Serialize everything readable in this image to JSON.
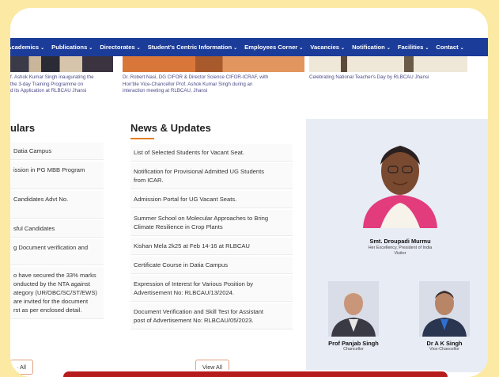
{
  "nav": {
    "items": [
      "Academics",
      "Publications",
      "Directorates",
      "Student's Centric Information",
      "Employees Corner",
      "Vacancies",
      "Notification",
      "Facilities",
      "Contact"
    ]
  },
  "gallery": {
    "captions": [
      "f. Ashok Kumar Singh inaugurating the\nthe 3-day Training Programme on\nd its Application at RLBCAU Jhansi",
      "Dr. Robert Nasi, DG CIFOR & Director Science CIFOR-ICRAF, with\nHon'ble Vice-Chancellor Prof. Ashok Kumar Singh during an\ninteraction meeting at RLBCAU, Jhansi",
      "Celebrating National Teacher's Day by RLBCAU Jhansi"
    ]
  },
  "circulars": {
    "title": "ulars",
    "items": [
      "Datia Campus",
      "ission in PG MBB Program",
      "Candidates Advt No.",
      "sful Candidates",
      "g Document verification and",
      "o have secured the 33% marks\nonducted by the NTA against\nategory (UR/OBC/SC/ST/EWS)\nare invited for the document\nrst as per enclosed detail."
    ],
    "view_all": "· All"
  },
  "news": {
    "title": "News & Updates",
    "items": [
      "List of Selected Students for Vacant Seat.",
      "Notification for Provisional Admitted UG Students\nfrom ICAR.",
      "Admission Portal for UG Vacant Seats.",
      "Summer School on Molecular Approaches to Bring\nClimate Resilience in Crop Plants",
      "Kishan Mela 2k25 at Feb 14-16 at RLBCAU",
      "Certificate Course in Datia Campus",
      "Expression of Interest for Various Position by\nAdvertisement No: RLBCAU/13/2024.",
      "Document Verification and Skill Test for Assistant\npost of Advertisement No: RLBCAU/05/2023."
    ],
    "view_all": "View All"
  },
  "visitor": {
    "name": "Smt. Droupadi Murmu",
    "title": "Her Excellency, President of India\nVisitor"
  },
  "chancellor": {
    "name": "Prof Panjab Singh",
    "title": "Chancellor"
  },
  "vice_chancellor": {
    "name": "Dr A K Singh",
    "title": "Vice-Chancellor"
  },
  "colors": {
    "nav": "#1c3c9a",
    "accent": "#e67e22",
    "panel": "#e8ecf5",
    "background": "#fbe9a4",
    "banner": "#b71c1c"
  }
}
